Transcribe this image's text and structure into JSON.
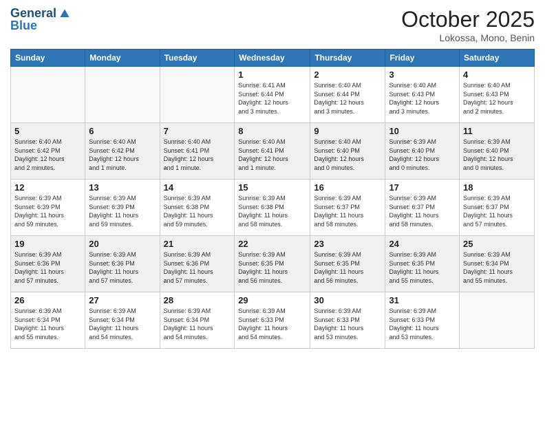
{
  "header": {
    "logo_line1": "General",
    "logo_line2": "Blue",
    "month": "October 2025",
    "location": "Lokossa, Mono, Benin"
  },
  "days_of_week": [
    "Sunday",
    "Monday",
    "Tuesday",
    "Wednesday",
    "Thursday",
    "Friday",
    "Saturday"
  ],
  "weeks": [
    [
      {
        "day": "",
        "info": ""
      },
      {
        "day": "",
        "info": ""
      },
      {
        "day": "",
        "info": ""
      },
      {
        "day": "1",
        "info": "Sunrise: 6:41 AM\nSunset: 6:44 PM\nDaylight: 12 hours\nand 3 minutes."
      },
      {
        "day": "2",
        "info": "Sunrise: 6:40 AM\nSunset: 6:44 PM\nDaylight: 12 hours\nand 3 minutes."
      },
      {
        "day": "3",
        "info": "Sunrise: 6:40 AM\nSunset: 6:43 PM\nDaylight: 12 hours\nand 3 minutes."
      },
      {
        "day": "4",
        "info": "Sunrise: 6:40 AM\nSunset: 6:43 PM\nDaylight: 12 hours\nand 2 minutes."
      }
    ],
    [
      {
        "day": "5",
        "info": "Sunrise: 6:40 AM\nSunset: 6:42 PM\nDaylight: 12 hours\nand 2 minutes."
      },
      {
        "day": "6",
        "info": "Sunrise: 6:40 AM\nSunset: 6:42 PM\nDaylight: 12 hours\nand 1 minute."
      },
      {
        "day": "7",
        "info": "Sunrise: 6:40 AM\nSunset: 6:41 PM\nDaylight: 12 hours\nand 1 minute."
      },
      {
        "day": "8",
        "info": "Sunrise: 6:40 AM\nSunset: 6:41 PM\nDaylight: 12 hours\nand 1 minute."
      },
      {
        "day": "9",
        "info": "Sunrise: 6:40 AM\nSunset: 6:40 PM\nDaylight: 12 hours\nand 0 minutes."
      },
      {
        "day": "10",
        "info": "Sunrise: 6:39 AM\nSunset: 6:40 PM\nDaylight: 12 hours\nand 0 minutes."
      },
      {
        "day": "11",
        "info": "Sunrise: 6:39 AM\nSunset: 6:40 PM\nDaylight: 12 hours\nand 0 minutes."
      }
    ],
    [
      {
        "day": "12",
        "info": "Sunrise: 6:39 AM\nSunset: 6:39 PM\nDaylight: 11 hours\nand 59 minutes."
      },
      {
        "day": "13",
        "info": "Sunrise: 6:39 AM\nSunset: 6:39 PM\nDaylight: 11 hours\nand 59 minutes."
      },
      {
        "day": "14",
        "info": "Sunrise: 6:39 AM\nSunset: 6:38 PM\nDaylight: 11 hours\nand 59 minutes."
      },
      {
        "day": "15",
        "info": "Sunrise: 6:39 AM\nSunset: 6:38 PM\nDaylight: 11 hours\nand 58 minutes."
      },
      {
        "day": "16",
        "info": "Sunrise: 6:39 AM\nSunset: 6:37 PM\nDaylight: 11 hours\nand 58 minutes."
      },
      {
        "day": "17",
        "info": "Sunrise: 6:39 AM\nSunset: 6:37 PM\nDaylight: 11 hours\nand 58 minutes."
      },
      {
        "day": "18",
        "info": "Sunrise: 6:39 AM\nSunset: 6:37 PM\nDaylight: 11 hours\nand 57 minutes."
      }
    ],
    [
      {
        "day": "19",
        "info": "Sunrise: 6:39 AM\nSunset: 6:36 PM\nDaylight: 11 hours\nand 57 minutes."
      },
      {
        "day": "20",
        "info": "Sunrise: 6:39 AM\nSunset: 6:36 PM\nDaylight: 11 hours\nand 57 minutes."
      },
      {
        "day": "21",
        "info": "Sunrise: 6:39 AM\nSunset: 6:36 PM\nDaylight: 11 hours\nand 57 minutes."
      },
      {
        "day": "22",
        "info": "Sunrise: 6:39 AM\nSunset: 6:35 PM\nDaylight: 11 hours\nand 56 minutes."
      },
      {
        "day": "23",
        "info": "Sunrise: 6:39 AM\nSunset: 6:35 PM\nDaylight: 11 hours\nand 56 minutes."
      },
      {
        "day": "24",
        "info": "Sunrise: 6:39 AM\nSunset: 6:35 PM\nDaylight: 11 hours\nand 55 minutes."
      },
      {
        "day": "25",
        "info": "Sunrise: 6:39 AM\nSunset: 6:34 PM\nDaylight: 11 hours\nand 55 minutes."
      }
    ],
    [
      {
        "day": "26",
        "info": "Sunrise: 6:39 AM\nSunset: 6:34 PM\nDaylight: 11 hours\nand 55 minutes."
      },
      {
        "day": "27",
        "info": "Sunrise: 6:39 AM\nSunset: 6:34 PM\nDaylight: 11 hours\nand 54 minutes."
      },
      {
        "day": "28",
        "info": "Sunrise: 6:39 AM\nSunset: 6:34 PM\nDaylight: 11 hours\nand 54 minutes."
      },
      {
        "day": "29",
        "info": "Sunrise: 6:39 AM\nSunset: 6:33 PM\nDaylight: 11 hours\nand 54 minutes."
      },
      {
        "day": "30",
        "info": "Sunrise: 6:39 AM\nSunset: 6:33 PM\nDaylight: 11 hours\nand 53 minutes."
      },
      {
        "day": "31",
        "info": "Sunrise: 6:39 AM\nSunset: 6:33 PM\nDaylight: 11 hours\nand 53 minutes."
      },
      {
        "day": "",
        "info": ""
      }
    ]
  ]
}
